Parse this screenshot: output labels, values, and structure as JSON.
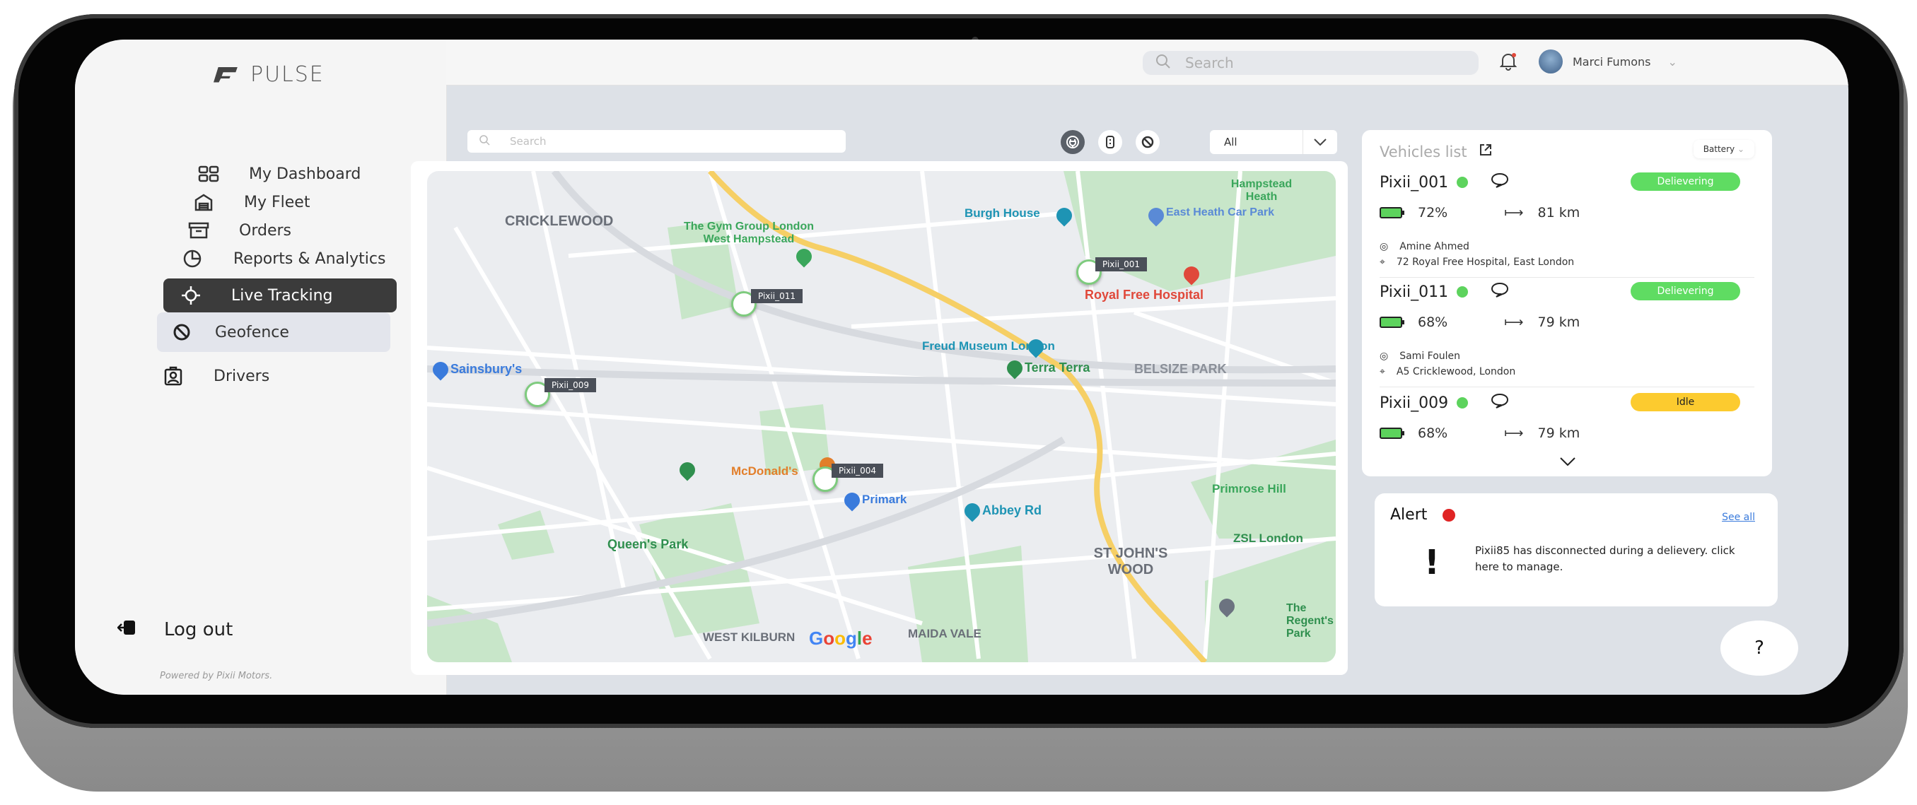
{
  "app": {
    "name": "PULSE",
    "powered_by": "Powered by Pixii Motors."
  },
  "sidebar": {
    "items": [
      {
        "label": "My Dashboard",
        "icon": "dashboard-grid-icon"
      },
      {
        "label": "My Fleet",
        "icon": "garage-icon"
      },
      {
        "label": "Orders",
        "icon": "archive-box-icon"
      },
      {
        "label": "Reports & Analytics",
        "icon": "pie-chart-icon"
      },
      {
        "label": "Live Tracking",
        "icon": "crosshair-icon",
        "active": true
      },
      {
        "label": "Geofence",
        "icon": "prohibited-icon",
        "sub": true
      },
      {
        "label": "Drivers",
        "icon": "badge-id-icon"
      }
    ],
    "logout": "Log out"
  },
  "topbar": {
    "search_placeholder": "Search",
    "user_name": "Marci Fumons",
    "notification_dot": true
  },
  "toolbar": {
    "search_placeholder": "Search",
    "filters": [
      {
        "icon": "charging-plug-icon",
        "active": true
      },
      {
        "icon": "battery-icon",
        "active": false
      },
      {
        "icon": "prohibited-icon",
        "active": false
      }
    ],
    "select_value": "All"
  },
  "map": {
    "areas": [
      "CRICKLEWOOD",
      "BELSIZE PARK",
      "ST JOHN'S WOOD",
      "WEST KILBURN",
      "MAIDA VALE"
    ],
    "pois": [
      {
        "name": "The Gym Group London West Hampstead",
        "color": "#3aa65b"
      },
      {
        "name": "Burgh House",
        "color": "#1e94b4"
      },
      {
        "name": "East Heath Car Park",
        "color": "#5a8ad6"
      },
      {
        "name": "Hampstead Heath",
        "color": "#3aa65b"
      },
      {
        "name": "Royal Free Hospital",
        "color": "#e0483a"
      },
      {
        "name": "Freud Museum London",
        "color": "#1e94b4"
      },
      {
        "name": "Terra Terra",
        "color": "#2f8f4e"
      },
      {
        "name": "Sainsbury's",
        "color": "#3a7bdc"
      },
      {
        "name": "McDonald's",
        "color": "#e27e2a"
      },
      {
        "name": "Primark",
        "color": "#3a7bdc"
      },
      {
        "name": "Abbey Rd",
        "color": "#1e94b4"
      },
      {
        "name": "Queen's Park",
        "color": "#2f8f4e"
      },
      {
        "name": "Primrose Hill",
        "color": "#3aa65b"
      },
      {
        "name": "ZSL London",
        "color": "#2f8f4e"
      },
      {
        "name": "The Regent's Park",
        "color": "#2f8f4e"
      }
    ],
    "vehicle_markers": [
      "Pixii_001",
      "Pixii_011",
      "Pixii_009",
      "Pixii_004"
    ],
    "google": "Google"
  },
  "vehicles": {
    "title": "Vehicles list",
    "sort": "Battery",
    "list": [
      {
        "id": "Pixii_001",
        "status": "Delievering",
        "status_color": "#5fdc62",
        "battery": "72%",
        "range": "81 km",
        "driver": "Amine Ahmed",
        "location": "72 Royal Free Hospital, East London"
      },
      {
        "id": "Pixii_011",
        "status": "Delievering",
        "status_color": "#5fdc62",
        "battery": "68%",
        "range": "79 km",
        "driver": "Sami Foulen",
        "location": "A5 Cricklewood, London"
      },
      {
        "id": "Pixii_009",
        "status": "Idle",
        "status_color": "#fccb2f",
        "battery": "68%",
        "range": "79 km"
      }
    ]
  },
  "alert": {
    "title": "Alert",
    "see_all": "See all",
    "message": "Pixii85 has disconnected during a delievery. click here to manage."
  },
  "help": "?"
}
